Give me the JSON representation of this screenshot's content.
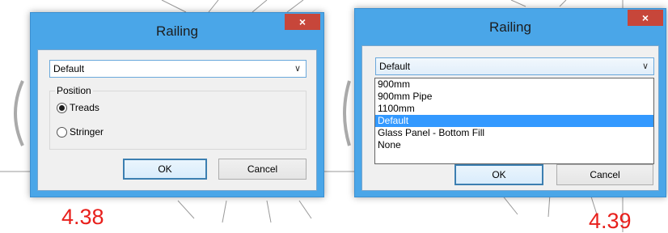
{
  "left_dialog": {
    "title": "Railing",
    "close_label": "×",
    "combo_value": "Default",
    "position_label": "Position",
    "radio_treads": "Treads",
    "radio_stringer": "Stringer",
    "ok_label": "OK",
    "cancel_label": "Cancel",
    "selected_position": "Treads"
  },
  "right_dialog": {
    "title": "Railing",
    "close_label": "×",
    "combo_value": "Default",
    "dropdown_options": [
      "900mm",
      "900mm Pipe",
      "1100mm",
      "Default",
      "Glass Panel - Bottom Fill",
      "None"
    ],
    "selected_index": 3,
    "ok_label": "OK",
    "cancel_label": "Cancel"
  },
  "captions": {
    "left": "4.38",
    "right": "4.39"
  },
  "colors": {
    "frame": "#4aa6e8",
    "close": "#c7463a",
    "caption": "#e8201c",
    "selection": "#3399ff"
  }
}
